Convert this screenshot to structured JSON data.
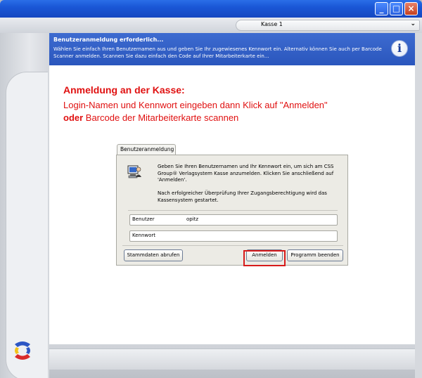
{
  "window": {
    "controls": {
      "minimize": "_",
      "maximize": "□",
      "close": "×"
    },
    "tab_label": "Kasse 1",
    "tab_chevron": "⌄"
  },
  "header": {
    "title": "Benutzeranmeldung erforderlich...",
    "text": "Wählen Sie einfach Ihren Benutzernamen aus und geben Sie Ihr zugewiesenes Kennwort ein. Alternativ können Sie auch per Barcode Scanner anmelden. Scannen Sie dazu einfach den Code auf Ihrer Mitarbeiterkarte ein...",
    "info_glyph": "i"
  },
  "instructions": {
    "line1": "Anmeldung an der Kasse:",
    "line2": "Login-Namen und Kennwort eingeben dann Klick auf \"Anmelden\"",
    "line3_strong": "oder",
    "line3_rest": " Barcode der Mitarbeiterkarte scannen"
  },
  "dialog": {
    "tab": "Benutzeranmeldung",
    "text1": "Geben Sie Ihren Benutzernamen und Ihr Kennwort ein, um sich am CSS Group® Verlagsystem Kasse anzumelden. Klicken Sie anschließend auf 'Anmelden'.",
    "text2": "Nach erfolgreicher Überprüfung Ihrer Zugangsberechtigung wird das Kassensystem gestartet.",
    "user_label": "Benutzer",
    "user_value": "opitz",
    "pw_label": "Kennwort",
    "pw_value": "",
    "btn_stammdaten": "Stammdaten abrufen",
    "btn_anmelden": "Anmelden",
    "btn_beenden": "Programm beenden"
  },
  "colors": {
    "accent_red": "#e01010",
    "header_blue": "#2a56bd",
    "highlight": "#d71b1b"
  }
}
